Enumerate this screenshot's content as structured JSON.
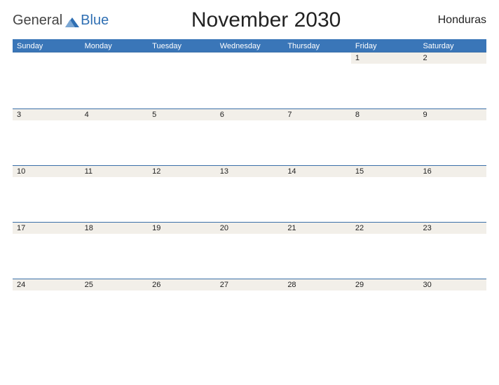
{
  "logo": {
    "part1": "General",
    "part2": "Blue"
  },
  "title": "November 2030",
  "country": "Honduras",
  "day_headers": [
    "Sunday",
    "Monday",
    "Tuesday",
    "Wednesday",
    "Thursday",
    "Friday",
    "Saturday"
  ],
  "weeks": [
    [
      "",
      "",
      "",
      "",
      "",
      "1",
      "2"
    ],
    [
      "3",
      "4",
      "5",
      "6",
      "7",
      "8",
      "9"
    ],
    [
      "10",
      "11",
      "12",
      "13",
      "14",
      "15",
      "16"
    ],
    [
      "17",
      "18",
      "19",
      "20",
      "21",
      "22",
      "23"
    ],
    [
      "24",
      "25",
      "26",
      "27",
      "28",
      "29",
      "30"
    ]
  ]
}
